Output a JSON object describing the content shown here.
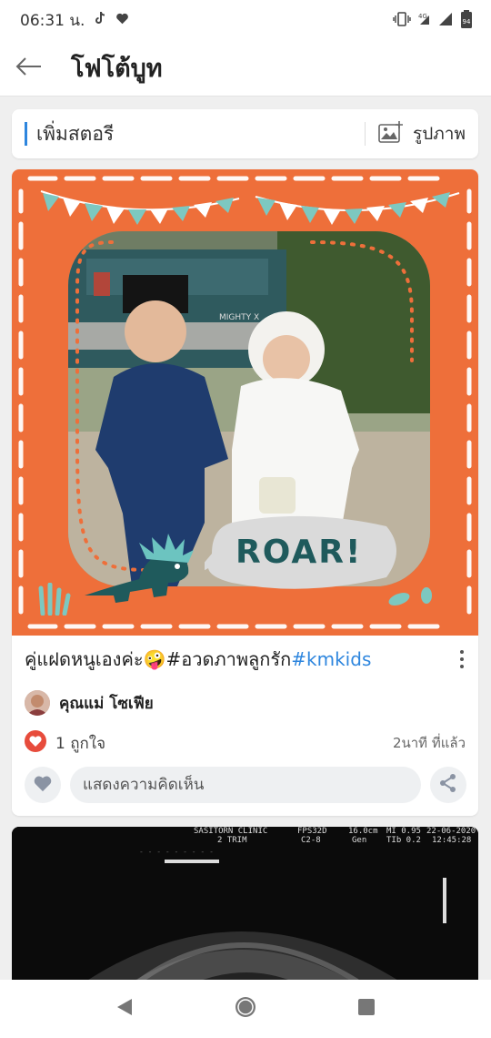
{
  "status_bar": {
    "time": "06:31 น.",
    "battery": "94",
    "icons": [
      "tiktok-icon",
      "heart-icon",
      "vibrate-icon",
      "signal-4g-icon",
      "signal-icon",
      "battery-icon"
    ]
  },
  "app_bar": {
    "title": "โฟโต้บูท",
    "back_icon": "arrow-left-icon"
  },
  "story_bar": {
    "label": "เพิ่มสตอรี",
    "photo_label": "รูปภาพ"
  },
  "post": {
    "image_sticker_text": "ROAR!",
    "vehicle_badge": "MIGHTY X",
    "caption_text": "คู่แฝดหนูเองค่ะ🤪",
    "caption_tag_1": "#อวดภาพลูกรัก",
    "caption_tag_2": "#kmkids",
    "author": "คุณแม่ โซเฟีย",
    "likes": "1 ถูกใจ",
    "time_ago": "2นาที ที่แล้ว",
    "comment_placeholder": "แสดงความคิดเห็น"
  },
  "post2": {
    "clinic": "SASITORN CLINIC",
    "trim": "2 TRIM",
    "fps": "FPS32D",
    "probe": "C2-8",
    "depth": "16.0cm",
    "gen": "Gen",
    "mi": "MI 0.95",
    "tib": "TIb 0.2",
    "date": "22-06-2020",
    "clock": "12:45:28"
  },
  "colors": {
    "frame_orange": "#ee6f3a",
    "accent_blue": "#2e86de",
    "like_red": "#e74c3c"
  }
}
